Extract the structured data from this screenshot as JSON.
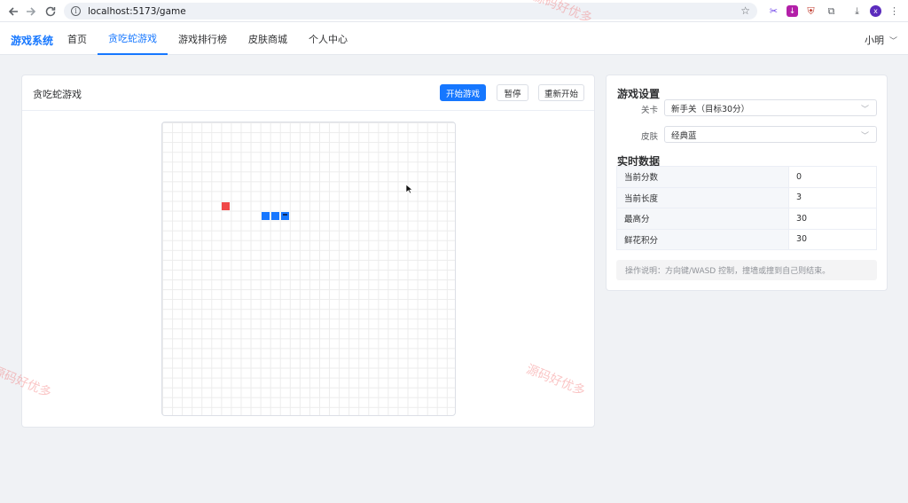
{
  "browser": {
    "url": "localhost:5173/game",
    "profile_initial": "x"
  },
  "nav": {
    "brand": "游戏系统",
    "items": [
      {
        "label": "首页",
        "active": false
      },
      {
        "label": "贪吃蛇游戏",
        "active": true
      },
      {
        "label": "游戏排行榜",
        "active": false
      },
      {
        "label": "皮肤商城",
        "active": false
      },
      {
        "label": "个人中心",
        "active": false
      }
    ],
    "user": "小明"
  },
  "game": {
    "title": "贪吃蛇游戏",
    "start_label": "开始游戏",
    "pause_label": "暂停",
    "restart_label": "重新开始",
    "grid_size": 30,
    "food": {
      "col": 6,
      "row": 8
    },
    "snake": [
      {
        "col": 12,
        "row": 9,
        "head": true
      },
      {
        "col": 11,
        "row": 9,
        "head": false
      },
      {
        "col": 10,
        "row": 9,
        "head": false
      }
    ]
  },
  "settings": {
    "title": "游戏设置",
    "level_label": "关卡",
    "level_value": "新手关（目标30分）",
    "skin_label": "皮肤",
    "skin_value": "经典蓝"
  },
  "stats": {
    "title": "实时数据",
    "rows": [
      {
        "label": "当前分数",
        "value": "0"
      },
      {
        "label": "当前长度",
        "value": "3"
      },
      {
        "label": "最高分",
        "value": "30"
      },
      {
        "label": "鲜花积分",
        "value": "30"
      }
    ]
  },
  "tip": "操作说明：方向键/WASD 控制，撞墙或撞到自己则结束。",
  "watermark": "源码好优多",
  "colors": {
    "accent": "#1677ff",
    "food": "#f04848"
  }
}
